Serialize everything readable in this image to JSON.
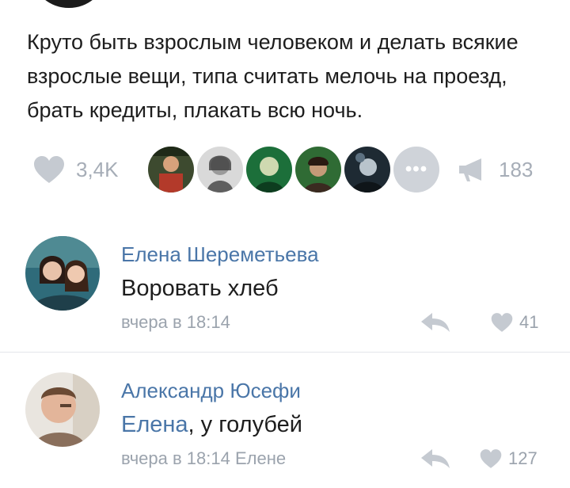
{
  "post": {
    "text": "Круто быть взрослым человеком и делать всякие взрослые вещи, типа считать мелочь на проезд, брать кредиты, плакать всю ночь.",
    "likes_count": "3,4K",
    "reposts_count": "183",
    "more_likers": "•••"
  },
  "comments": [
    {
      "author": "Елена Шереметьева",
      "text": "Воровать хлеб",
      "mention": "",
      "meta": "вчера в 18:14",
      "likes": "41"
    },
    {
      "author": "Александр Юсефи",
      "mention": "Елена",
      "text": ", у голубей",
      "meta": "вчера в 18:14 Елене",
      "likes": "127"
    }
  ],
  "colors": {
    "link": "#4a76a8",
    "muted": "#a6adb7",
    "text": "#1d1d1d"
  }
}
